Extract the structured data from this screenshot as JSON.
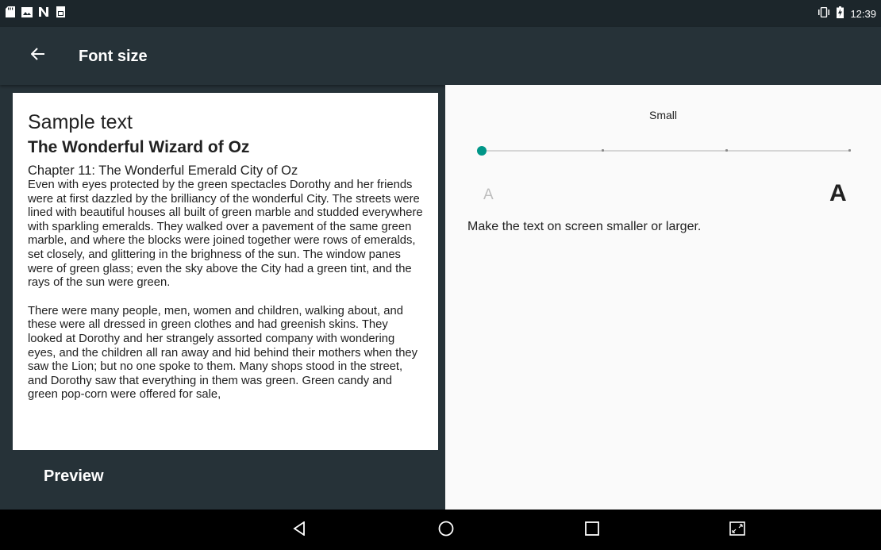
{
  "status_bar": {
    "left_icons": [
      "sd-card-icon",
      "image-icon",
      "n-icon",
      "sim-card-icon"
    ],
    "time": "12:39",
    "right_icons": [
      "vibrate-icon",
      "battery-charging-icon"
    ]
  },
  "app_bar": {
    "back_icon": "arrow-back-icon",
    "title": "Font size"
  },
  "preview": {
    "heading": "Sample text",
    "book_title": "The Wonderful Wizard of Oz",
    "chapter": "Chapter 11: The Wonderful Emerald City of Oz",
    "paragraphs": [
      "Even with eyes protected by the green spectacles Dorothy and her friends were at first dazzled by the brilliancy of the wonderful City. The streets were lined with beautiful houses all built of green marble and studded everywhere with sparkling emeralds. They walked over a pavement of the same green marble, and where the blocks were joined together were rows of emeralds, set closely, and glittering in the brighness of the sun. The window panes were of green glass; even the sky above the City had a green tint, and the rays of the sun were green.",
      "There were many people, men, women and children, walking about, and these were all dressed in green clothes and had greenish skins. They looked at Dorothy and her strangely assorted company with wondering eyes, and the children all ran away and hid behind their mothers when they saw the Lion; but no one spoke to them. Many shops stood in the street, and Dorothy saw that everything in them was green. Green candy and green pop-corn were offered for sale,"
    ],
    "label": "Preview"
  },
  "settings": {
    "current_size": "Small",
    "slider": {
      "steps": 4,
      "selected_index": 0,
      "accent": "#009688"
    },
    "small_glyph": "A",
    "large_glyph": "A",
    "description": "Make the text on screen smaller or larger."
  },
  "nav_bar": {
    "buttons": [
      "back-triangle-icon",
      "home-circle-icon",
      "recents-square-icon",
      "screen-resize-icon"
    ]
  }
}
